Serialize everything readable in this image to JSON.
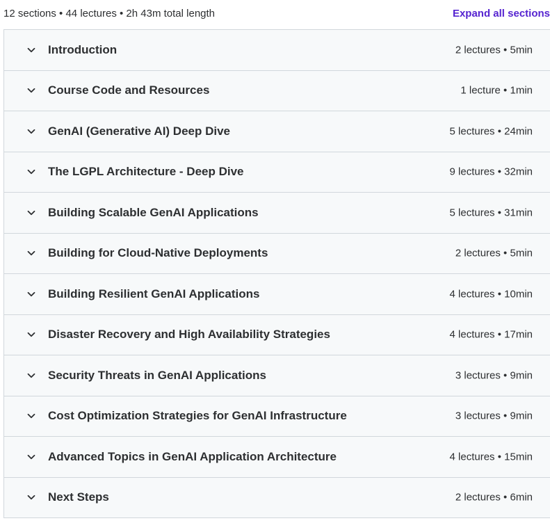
{
  "summary": {
    "text": "12 sections • 44 lectures • 2h 43m total length",
    "expand_label": "Expand all sections"
  },
  "sections": [
    {
      "title": "Introduction",
      "meta": "2 lectures • 5min"
    },
    {
      "title": "Course Code and Resources",
      "meta": "1 lecture • 1min"
    },
    {
      "title": "GenAI (Generative AI) Deep Dive",
      "meta": "5 lectures • 24min"
    },
    {
      "title": "The LGPL Architecture - Deep Dive",
      "meta": "9 lectures • 32min"
    },
    {
      "title": "Building Scalable GenAI Applications",
      "meta": "5 lectures • 31min"
    },
    {
      "title": "Building for Cloud-Native Deployments",
      "meta": "2 lectures • 5min"
    },
    {
      "title": "Building Resilient GenAI Applications",
      "meta": "4 lectures • 10min"
    },
    {
      "title": "Disaster Recovery and High Availability Strategies",
      "meta": "4 lectures • 17min"
    },
    {
      "title": "Security Threats in GenAI Applications",
      "meta": "3 lectures • 9min"
    },
    {
      "title": "Cost Optimization Strategies for GenAI Infrastructure",
      "meta": "3 lectures • 9min"
    },
    {
      "title": "Advanced Topics in GenAI Application Architecture",
      "meta": "4 lectures • 15min"
    },
    {
      "title": "Next Steps",
      "meta": "2 lectures • 6min"
    }
  ],
  "icons": {
    "section_toggle": "chevron-down-icon"
  },
  "colors": {
    "accent": "#5624d0",
    "row_background": "#f7f9fa",
    "border": "#d1d7dc",
    "text": "#2d2f31"
  }
}
